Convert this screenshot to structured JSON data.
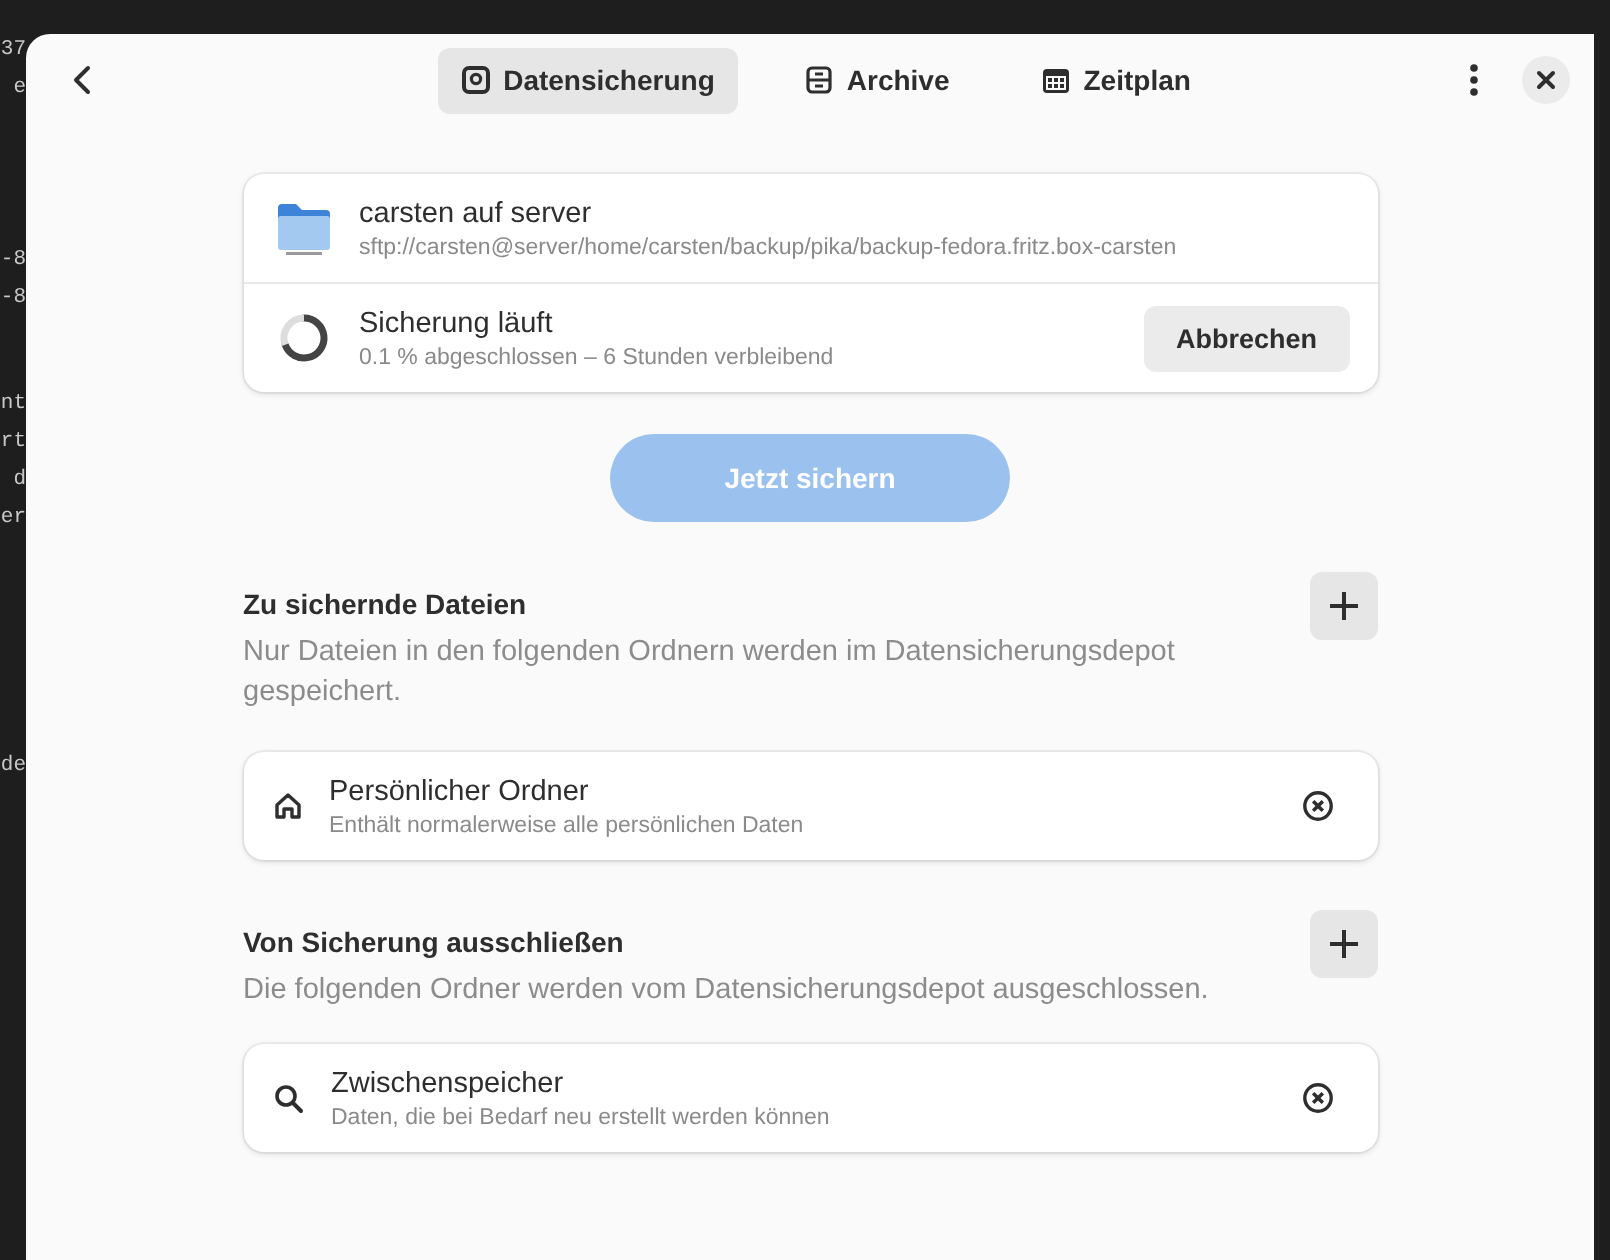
{
  "background_terminal": {
    "blocks": [
      [
        "37",
        "e"
      ],
      [
        "-8",
        "-8"
      ],
      [
        "nt",
        "rt",
        "d",
        "er"
      ],
      [
        "de"
      ]
    ]
  },
  "header": {
    "tabs": [
      {
        "label": "Datensicherung",
        "selected": true
      },
      {
        "label": "Archive",
        "selected": false
      },
      {
        "label": "Zeitplan",
        "selected": false
      }
    ]
  },
  "repository": {
    "title": "carsten auf server",
    "path": "sftp://carsten@server/home/carsten/backup/pika/backup-fedora.fritz.box-carsten"
  },
  "status": {
    "title": "Sicherung läuft",
    "detail": "0.1 % abgeschlossen – 6 Stunden verbleibend",
    "cancel_button": "Abbrechen"
  },
  "backup_button": {
    "label": "Jetzt sichern",
    "disabled": true
  },
  "sections": [
    {
      "title": "Zu sichernde Dateien",
      "description": "Nur Dateien in den folgenden Ordnern werden im Datensicherungsdepot gespeichert.",
      "items": [
        {
          "title": "Persönlicher Ordner",
          "subtitle": "Enthält normalerweise alle persönlichen Daten"
        }
      ]
    },
    {
      "title": "Von Sicherung ausschließen",
      "description": "Die folgenden Ordner werden vom Datensicherungsdepot ausgeschlossen.",
      "items": [
        {
          "title": "Zwischenspeicher",
          "subtitle": "Daten, die bei Bedarf neu erstellt werden können"
        }
      ]
    }
  ]
}
